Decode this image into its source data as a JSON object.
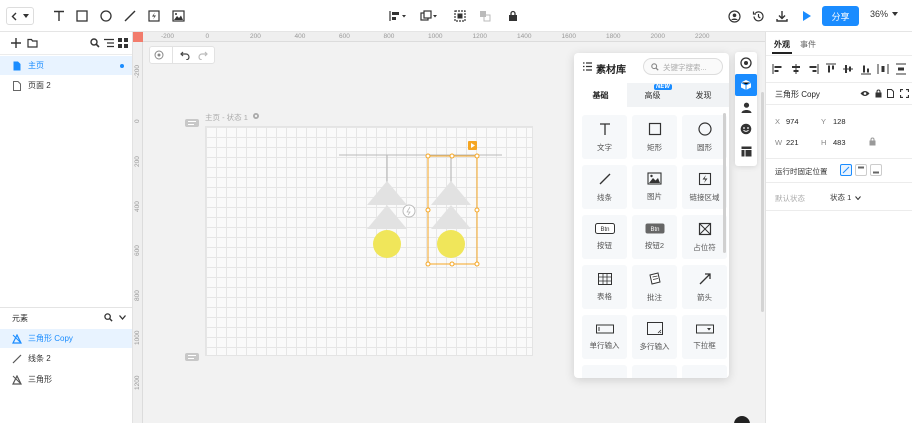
{
  "toolbar": {
    "share_label": "分享",
    "zoom": "36%"
  },
  "left_panel": {
    "pages": [
      {
        "label": "主页",
        "active": true
      },
      {
        "label": "页面 2",
        "active": false
      }
    ],
    "elements_title": "元素",
    "elements": [
      {
        "label": "三角形 Copy",
        "active": true
      },
      {
        "label": "线条 2",
        "active": false
      },
      {
        "label": "三角形",
        "active": false
      }
    ]
  },
  "canvas": {
    "state_label": "主页 - 状态 1",
    "ruler_top": [
      "-200",
      "0",
      "200",
      "400",
      "600",
      "800",
      "1000",
      "1200",
      "1400",
      "1600",
      "1800",
      "2000",
      "2200"
    ],
    "ruler_left": [
      "-200",
      "0",
      "200",
      "400",
      "600",
      "800",
      "1000",
      "1200"
    ]
  },
  "library": {
    "title": "素材库",
    "search_placeholder": "关键字搜索...",
    "tabs": [
      {
        "label": "基础",
        "active": true
      },
      {
        "label": "高级",
        "active": false,
        "badge": "NEW"
      },
      {
        "label": "发现",
        "active": false
      }
    ],
    "items": [
      {
        "label": "文字",
        "icon": "text-icon"
      },
      {
        "label": "矩形",
        "icon": "rectangle-icon"
      },
      {
        "label": "圆形",
        "icon": "circle-icon"
      },
      {
        "label": "线条",
        "icon": "line-icon"
      },
      {
        "label": "图片",
        "icon": "image-icon"
      },
      {
        "label": "链接区域",
        "icon": "hotspot-icon"
      },
      {
        "label": "按钮",
        "icon": "button-icon",
        "badge": "Btn"
      },
      {
        "label": "按钮2",
        "icon": "button2-icon",
        "badge": "Btn"
      },
      {
        "label": "占位符",
        "icon": "placeholder-icon"
      },
      {
        "label": "表格",
        "icon": "table-icon"
      },
      {
        "label": "批注",
        "icon": "note-icon"
      },
      {
        "label": "箭头",
        "icon": "arrow-icon"
      },
      {
        "label": "单行输入",
        "icon": "single-input-icon"
      },
      {
        "label": "多行输入",
        "icon": "multi-input-icon"
      },
      {
        "label": "下拉框",
        "icon": "dropdown-icon"
      }
    ]
  },
  "right_panel": {
    "tabs": [
      {
        "label": "外观",
        "active": true
      },
      {
        "label": "事件",
        "active": false
      }
    ],
    "element_name": "三角形 Copy",
    "x_label": "X",
    "x_value": "974",
    "y_label": "Y",
    "y_value": "128",
    "w_label": "W",
    "w_value": "221",
    "h_label": "H",
    "h_value": "483",
    "fixed_label": "运行时固定位置",
    "default_state_label": "默认状态",
    "default_state_value": "状态 1"
  },
  "colors": {
    "accent": "#1a8cff",
    "selection": "#f5a623",
    "circle_fill": "#f0e65a",
    "triangle_fill": "#e0e0e0"
  }
}
